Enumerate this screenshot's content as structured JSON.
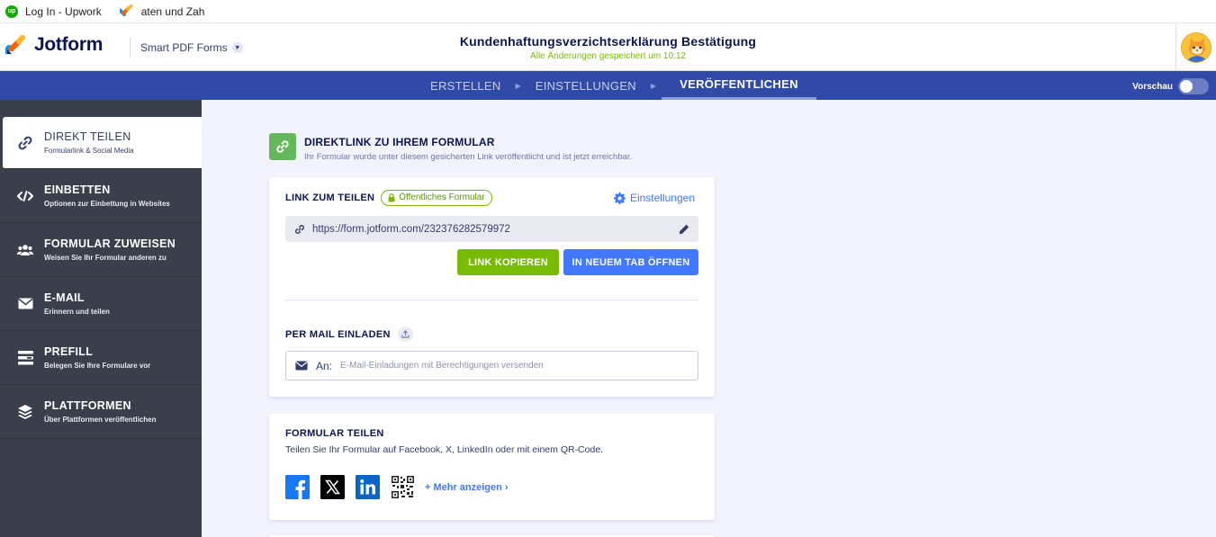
{
  "bookmarks": [
    {
      "label": "Log In - Upwork",
      "icon": "upwork-icon"
    },
    {
      "label": "aten und Zah",
      "icon": "jotform-icon"
    }
  ],
  "header": {
    "logo_text": "Jotform",
    "product": "Smart PDF Forms",
    "form_title": "Kundenhaftungsverzichtserklärung Bestätigung",
    "saved_status": "Alle Änderungen gespeichert um 10:12",
    "saved_color": "#78bb07"
  },
  "nav": {
    "tabs": [
      "ERSTELLEN",
      "EINSTELLUNGEN",
      "VERÖFFENTLICHEN"
    ],
    "active_tab": "VERÖFFENTLICHEN",
    "preview_label": "Vorschau",
    "bar_color": "#324aa7"
  },
  "sidebar": {
    "items": [
      {
        "title": "DIREKT TEILEN",
        "subtitle": "Formularlink & Social Media",
        "icon": "link-icon",
        "active": true
      },
      {
        "title": "EINBETTEN",
        "subtitle": "Optionen zur Einbettung in Websites",
        "icon": "code-icon",
        "active": false
      },
      {
        "title": "FORMULAR ZUWEISEN",
        "subtitle": "Weisen Sie Ihr Formular anderen zu",
        "icon": "users-icon",
        "active": false
      },
      {
        "title": "E-MAIL",
        "subtitle": "Erinnern und teilen",
        "icon": "envelope-icon",
        "active": false
      },
      {
        "title": "PREFILL",
        "subtitle": "Belegen Sie Ihre Formulare vor",
        "icon": "prefill-icon",
        "active": false
      },
      {
        "title": "PLATTFORMEN",
        "subtitle": "Über Plattformen veröffentlichen",
        "icon": "layers-icon",
        "active": false
      }
    ]
  },
  "intro": {
    "title": "DIREKTLINK ZU IHREM FORMULAR",
    "subtitle": "Ihr Formular wurde unter diesem gesicherten Link veröffentlicht und ist jetzt erreichbar."
  },
  "link_card": {
    "label": "LINK ZUM TEILEN",
    "badge": "Öffentliches Formular",
    "settings_label": "Einstellungen",
    "url": "https://form.jotform.com/232376282579972",
    "copy_button": "LINK KOPIEREN",
    "open_button": "IN NEUEM TAB ÖFFNEN",
    "mail_label": "PER MAIL EINLADEN",
    "mail_to": "An:",
    "mail_placeholder": "E-Mail-Einladungen mit Berechtigungen versenden"
  },
  "share_card": {
    "title": "FORMULAR TEILEN",
    "subtitle": "Teilen Sie Ihr Formular auf Facebook, X, LinkedIn oder mit einem QR-Code.",
    "more_label": "Mehr anzeigen",
    "socials": [
      "facebook-icon",
      "x-icon",
      "linkedin-icon",
      "qr-code-icon"
    ]
  },
  "colors": {
    "green": "#78bb07",
    "blue": "#4277ff",
    "sidebar": "#3a3f4c"
  }
}
